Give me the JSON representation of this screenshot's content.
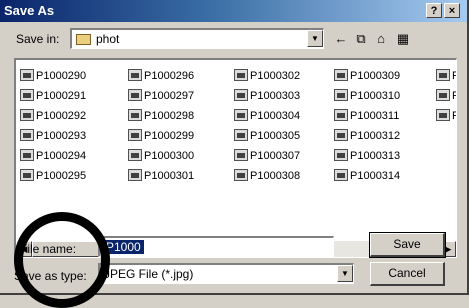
{
  "window": {
    "title": "Save As",
    "help_glyph": "?",
    "close_glyph": "×"
  },
  "save_in": {
    "label": "Save in:",
    "folder": "phot"
  },
  "toolbar": {
    "back_glyph": "←",
    "up_glyph": "⧉",
    "new_folder_glyph": "⌂",
    "views_glyph": "▦"
  },
  "files": [
    "P1000290",
    "P1000291",
    "P1000292",
    "P1000293",
    "P1000294",
    "P1000295",
    "P1000296",
    "P1000297",
    "P1000298",
    "P1000299",
    "P1000300",
    "P1000301",
    "P1000302",
    "P1000303",
    "P1000304",
    "P1000305",
    "P1000307",
    "P1000308",
    "P1000309",
    "P1000310",
    "P1000311",
    "P1000312",
    "P1000313",
    "P1000314",
    "P",
    "P",
    "P"
  ],
  "file_name": {
    "label": "File name:",
    "value": "P1000"
  },
  "save_as_type": {
    "label": "Save as type:",
    "value": "JPEG File (*.jpg)"
  },
  "buttons": {
    "save": "Save",
    "cancel": "Cancel"
  }
}
